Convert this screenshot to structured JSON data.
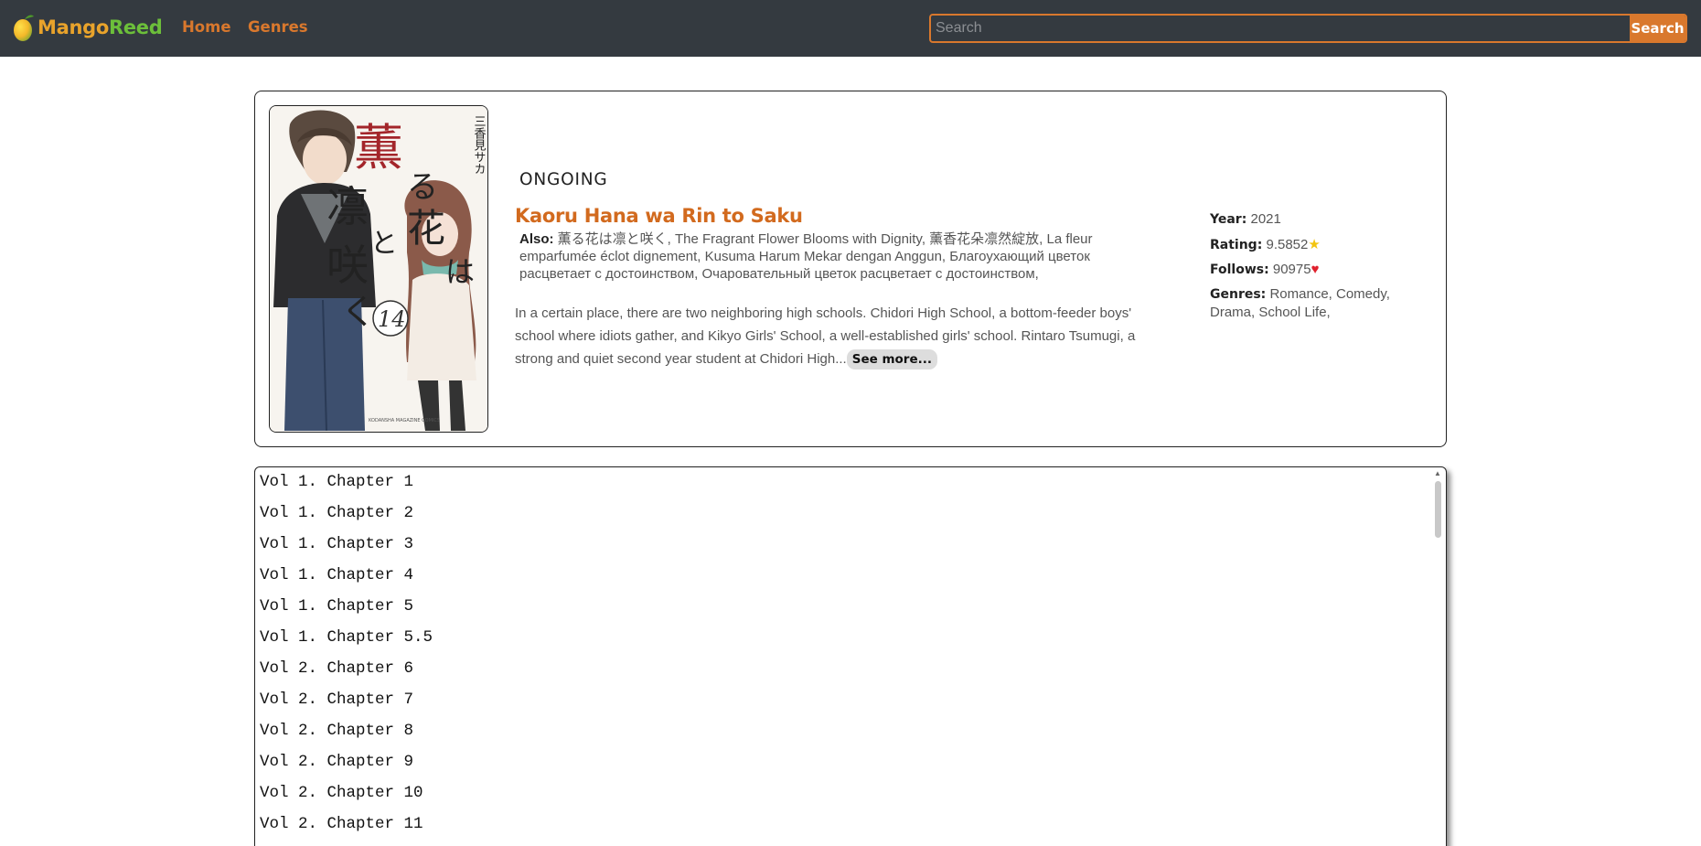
{
  "navbar": {
    "logo_part1": "Mango",
    "logo_part2": "Reed",
    "links": [
      "Home",
      "Genres"
    ],
    "search_placeholder": "Search",
    "search_button": "Search"
  },
  "manga": {
    "status": "ONGOING",
    "title": "Kaoru Hana wa Rin to Saku",
    "also_label": "Also:",
    "also_text": "薫る花は凛と咲く, The Fragrant Flower Blooms with Dignity, 薰香花朵凛然綻放, La fleur emparfumée éclot dignement, Kusuma Harum Mekar dengan Anggun, Благоухающий цветок расцветает с достоинством, Очаровательный цветок расцветает с достоинством,",
    "description": "In a certain place, there are two neighboring high schools. Chidori High School, a bottom-feeder boys' school where idiots gather, and Kikyo Girls' School, a well-established girls' school. Rintaro Tsumugi, a strong and quiet second year student at Chidori High...",
    "see_more": "See more...",
    "year_label": "Year:",
    "year": "2021",
    "rating_label": "Rating:",
    "rating": "9.5852",
    "follows_label": "Follows:",
    "follows": "90975",
    "genres_label": "Genres:",
    "genres": "Romance, Comedy, Drama, School Life,"
  },
  "cover": {
    "title_glyphs": [
      "薫",
      "る",
      "花",
      "は",
      "凛",
      "と",
      "咲",
      "く"
    ],
    "volume_number": "14",
    "author": "三香見サカ",
    "publisher_mark": "KODANSHA MAGAZINE COMICS"
  },
  "chapters": [
    "Vol 1. Chapter 1",
    "Vol 1. Chapter 2",
    "Vol 1. Chapter 3",
    "Vol 1. Chapter 4",
    "Vol 1. Chapter 5",
    "Vol 1. Chapter 5.5",
    "Vol 2. Chapter 6",
    "Vol 2. Chapter 7",
    "Vol 2. Chapter 8",
    "Vol 2. Chapter 9",
    "Vol 2. Chapter 10",
    "Vol 2. Chapter 11"
  ],
  "colors": {
    "navbar_bg": "#343a40",
    "accent": "#d9782d",
    "title": "#d26a1e",
    "logo_green": "#6cbf3a"
  },
  "icons": {
    "logo": "mango-icon",
    "rating": "star-icon",
    "follows": "heart-icon"
  }
}
